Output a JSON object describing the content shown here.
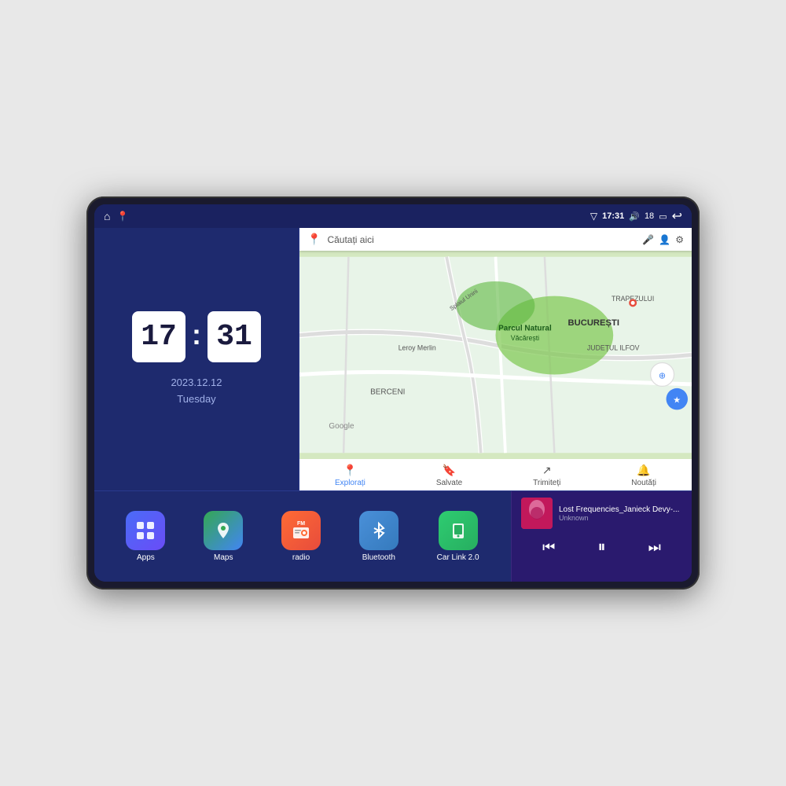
{
  "device": {
    "status_bar": {
      "time": "17:31",
      "battery": "18",
      "nav_home_icon": "⌂",
      "nav_maps_icon": "📍",
      "signal_icon": "▽",
      "volume_icon": "🔊",
      "battery_icon": "🔋",
      "back_icon": "↩"
    },
    "clock": {
      "hour": "17",
      "minute": "31",
      "date": "2023.12.12",
      "day": "Tuesday"
    },
    "map": {
      "search_placeholder": "Căutați aici",
      "footer_items": [
        {
          "label": "Explorați",
          "active": true
        },
        {
          "label": "Salvate",
          "active": false
        },
        {
          "label": "Trimiteți",
          "active": false
        },
        {
          "label": "Noutăți",
          "active": false
        }
      ],
      "places": [
        "Parcul Natural Văcărești",
        "Leroy Merlin",
        "BUCUREȘTI",
        "JUDEȚUL ILFOV",
        "TRAPEZULUI",
        "BERCENI",
        "Splaiul Unirii"
      ]
    },
    "apps": [
      {
        "id": "apps",
        "label": "Apps",
        "icon_class": "icon-apps",
        "icon": "⊞"
      },
      {
        "id": "maps",
        "label": "Maps",
        "icon_class": "icon-maps",
        "icon": "📍"
      },
      {
        "id": "radio",
        "label": "radio",
        "icon_class": "icon-radio",
        "icon": "📻"
      },
      {
        "id": "bluetooth",
        "label": "Bluetooth",
        "icon_class": "icon-bluetooth",
        "icon": "⬡"
      },
      {
        "id": "carlink",
        "label": "Car Link 2.0",
        "icon_class": "icon-carlink",
        "icon": "📱"
      }
    ],
    "music": {
      "title": "Lost Frequencies_Janieck Devy-...",
      "artist": "Unknown",
      "prev_icon": "⏮",
      "play_icon": "⏸",
      "next_icon": "⏭"
    }
  }
}
